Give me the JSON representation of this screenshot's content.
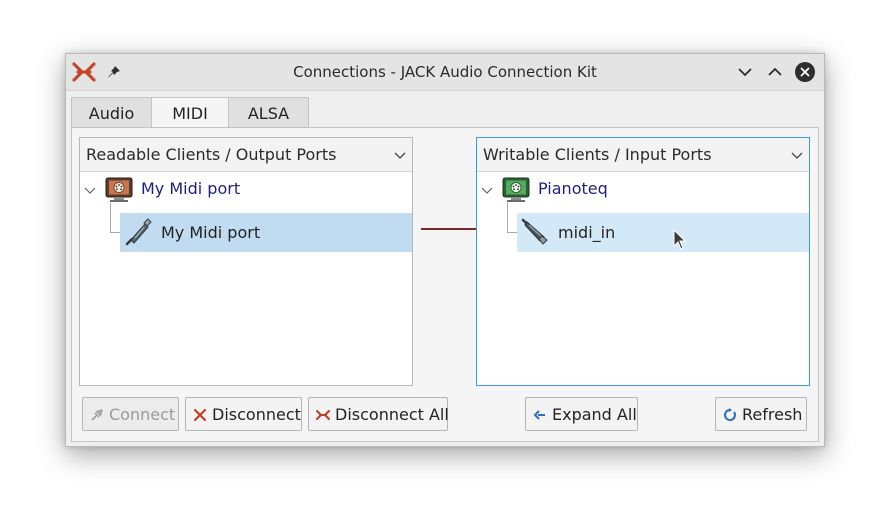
{
  "window": {
    "title": "Connections - JACK Audio Connection Kit"
  },
  "tabs": [
    {
      "label": "Audio",
      "active": false
    },
    {
      "label": "MIDI",
      "active": true
    },
    {
      "label": "ALSA",
      "active": false
    }
  ],
  "readable_panel": {
    "header": "Readable Clients / Output Ports",
    "client": {
      "label": "My Midi port",
      "icon": "midi-client-icon"
    },
    "ports": [
      {
        "label": "My Midi port",
        "icon": "midi-plug-icon",
        "selected": true
      }
    ]
  },
  "writable_panel": {
    "header": "Writable Clients / Input Ports",
    "client": {
      "label": "Pianoteq",
      "icon": "midi-client-icon"
    },
    "ports": [
      {
        "label": "midi_in",
        "icon": "midi-socket-icon",
        "hovered": true
      }
    ]
  },
  "buttons": {
    "connect": "Connect",
    "disconnect": "Disconnect",
    "disconnect_all": "Disconnect All",
    "expand_all": "Expand All",
    "refresh": "Refresh"
  },
  "colors": {
    "accent": "#3d9ae0",
    "selection": "#c1dcf1",
    "hover": "#d4e9f8",
    "connection": "#7b2a2a",
    "client_text": "#1f1f80",
    "logo": "#c5472b"
  }
}
